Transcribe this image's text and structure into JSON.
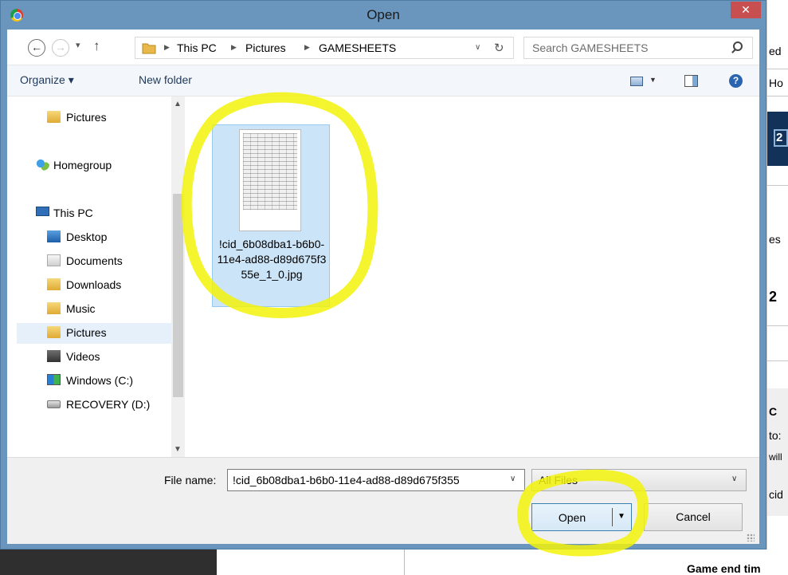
{
  "window": {
    "title": "Open",
    "close_symbol": "✕"
  },
  "address": {
    "crumbs": [
      "This PC",
      "Pictures",
      "GAMESHEETS"
    ],
    "search_placeholder": "Search GAMESHEETS"
  },
  "toolbar": {
    "organize_label": "Organize ▾",
    "new_folder_label": "New folder",
    "help_symbol": "?"
  },
  "nav_pane": {
    "items": [
      {
        "label": "Pictures",
        "icon": "pictures-folder-icon"
      },
      {
        "label": "Homegroup",
        "icon": "homegroup-icon"
      },
      {
        "label": "This PC",
        "icon": "computer-icon"
      },
      {
        "label": "Desktop",
        "icon": "desktop-folder-icon"
      },
      {
        "label": "Documents",
        "icon": "documents-folder-icon"
      },
      {
        "label": "Downloads",
        "icon": "downloads-folder-icon"
      },
      {
        "label": "Music",
        "icon": "music-folder-icon"
      },
      {
        "label": "Pictures",
        "icon": "pictures-folder-icon",
        "selected": true
      },
      {
        "label": "Videos",
        "icon": "videos-folder-icon"
      },
      {
        "label": "Windows (C:)",
        "icon": "windows-drive-icon"
      },
      {
        "label": "RECOVERY (D:)",
        "icon": "drive-icon"
      }
    ]
  },
  "files": [
    {
      "name": "!cid_6b08dba1-b6b0-11e4-ad88-d89d675f355e_1_0.jpg",
      "selected": true
    }
  ],
  "bottom": {
    "file_name_label": "File name:",
    "file_name_value": "!cid_6b08dba1-b6b0-11e4-ad88-d89d675f355",
    "file_type_value": "All Files",
    "open_label": "Open",
    "cancel_label": "Cancel"
  },
  "background_page": {
    "fragments": [
      "ed",
      "Ho",
      "2",
      "es",
      "2",
      "C",
      "to:",
      "will",
      "cid"
    ],
    "footer_text": "Game end tim"
  },
  "colors": {
    "title_bar": "#6a95bd",
    "close_button": "#c74f4f",
    "selection": "#cce4f7",
    "highlighter": "#f2f20a"
  }
}
